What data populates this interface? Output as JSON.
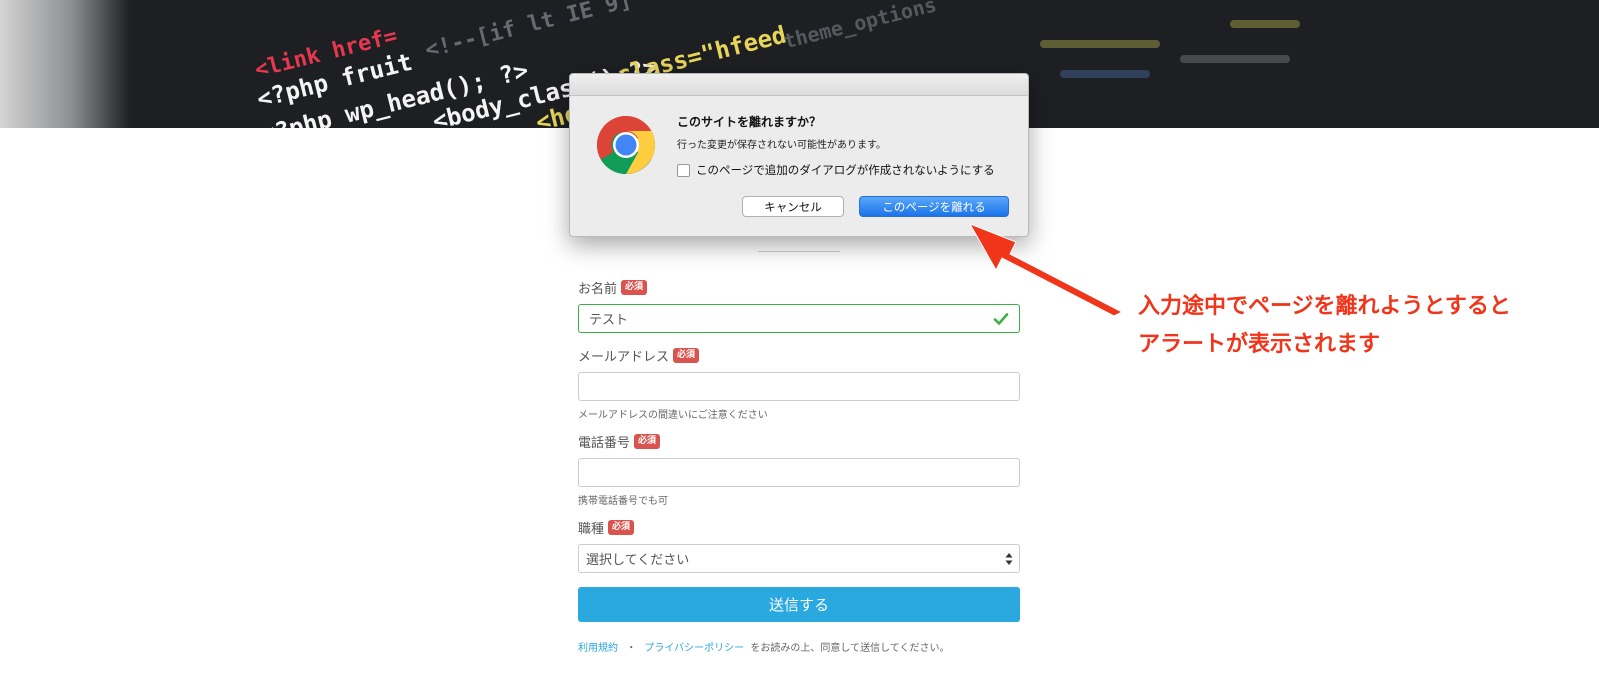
{
  "hero": {
    "code_lines": [
      "<link href=",
      "<?php fruit",
      "<!--[if lt IE 9]",
      "<?php wp_head(); ?>",
      "<body_class();?>",
      "class=\"hfeed",
      "<heade",
      "theme_options"
    ]
  },
  "form": {
    "name": {
      "label": "お名前",
      "badge": "必須",
      "value": "テスト"
    },
    "email": {
      "label": "メールアドレス",
      "badge": "必須",
      "value": "",
      "help": "メールアドレスの間違いにご注意ください"
    },
    "phone": {
      "label": "電話番号",
      "badge": "必須",
      "value": "",
      "help": "携帯電話番号でも可"
    },
    "job": {
      "label": "職種",
      "badge": "必須",
      "selected": "選択してください"
    },
    "submit_label": "送信する",
    "agreement": {
      "terms_link": "利用規約",
      "separator": "・",
      "privacy_link": "プライバシーポリシー",
      "text": "をお読みの上、同意して送信してください。"
    }
  },
  "dialog": {
    "title": "このサイトを離れますか？",
    "message": "行った変更が保存されない可能性があります。",
    "checkbox_label": "このページで追加のダイアログが作成されないようにする",
    "cancel_label": "キャンセル",
    "leave_label": "このページを離れる"
  },
  "annotation": {
    "line1": "入力途中でページを離れようとすると",
    "line2": "アラートが表示されます"
  },
  "colors": {
    "required_badge": "#d9534f",
    "submit": "#2aa8e0",
    "valid_border": "#3cb043",
    "annotation": "#f0351b",
    "dialog_primary": "#1a73e8"
  }
}
